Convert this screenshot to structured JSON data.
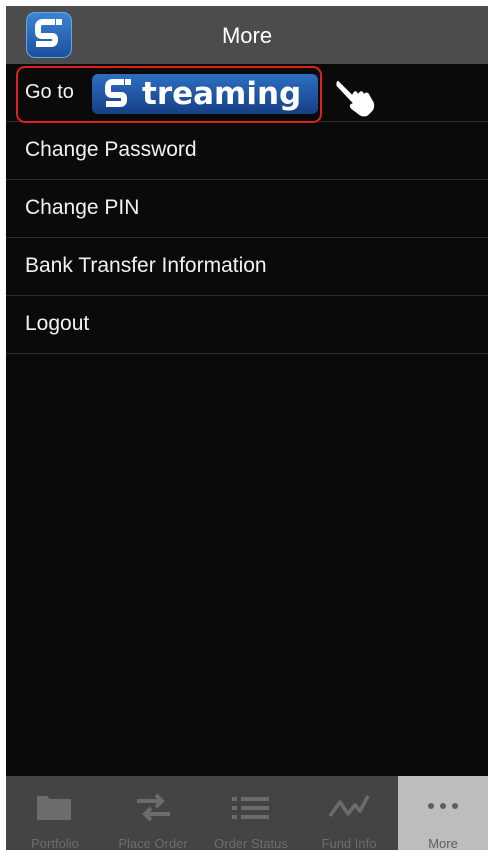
{
  "header": {
    "title": "More",
    "app_icon": "streaming-s-logo-icon"
  },
  "menu": {
    "goto": {
      "prefix": "Go to",
      "brand": "treaming",
      "brand_icon": "streaming-s-logo-icon",
      "pointer_icon": "pointing-hand-icon",
      "highlight_color": "#e02020"
    },
    "items": [
      {
        "label": "Change Password"
      },
      {
        "label": "Change PIN"
      },
      {
        "label": "Bank Transfer Information"
      },
      {
        "label": "Logout"
      }
    ]
  },
  "tabs": [
    {
      "label": "Portfolio",
      "icon": "folder-icon",
      "active": false
    },
    {
      "label": "Place Order",
      "icon": "swap-arrows-icon",
      "active": false
    },
    {
      "label": "Order Status",
      "icon": "list-icon",
      "active": false
    },
    {
      "label": "Fund Info",
      "icon": "line-chart-icon",
      "active": false
    },
    {
      "label": "More",
      "icon": "more-dots-icon",
      "active": true
    }
  ],
  "colors": {
    "background": "#0a0a0a",
    "header": "#4c4c4c",
    "tabbar": "#444444",
    "active_tab": "#bdbdbd"
  }
}
